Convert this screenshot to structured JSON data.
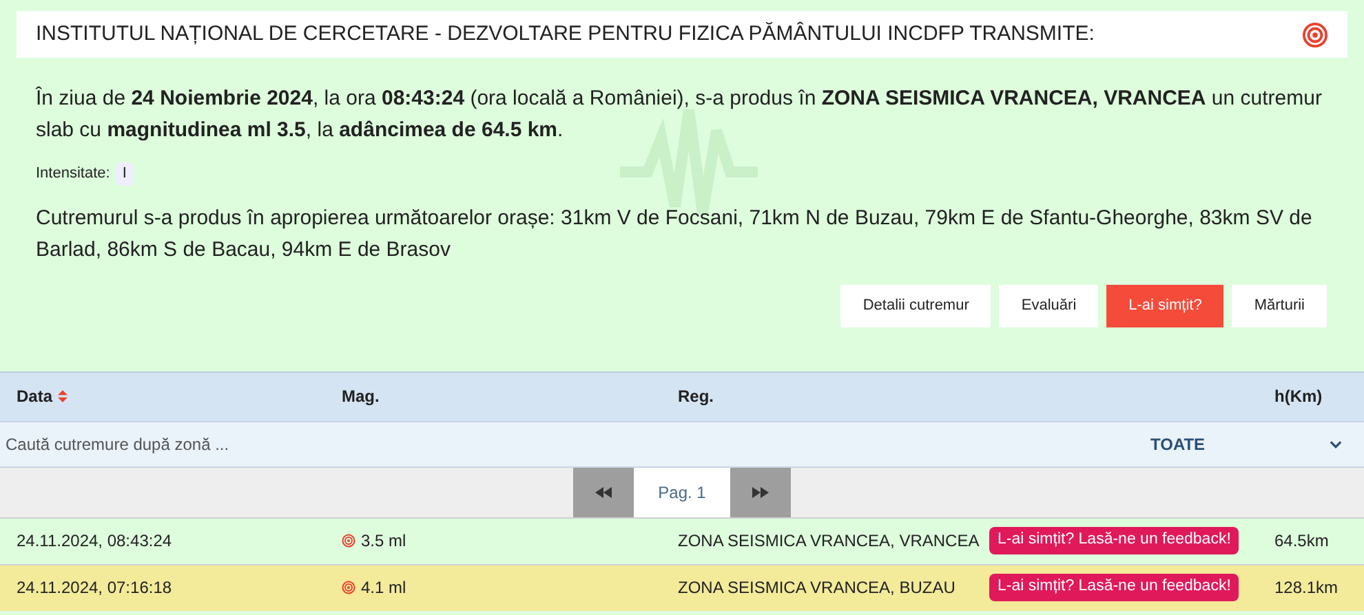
{
  "header": {
    "title": "INSTITUTUL NAȚIONAL DE CERCETARE - DEZVOLTARE PENTRU FIZICA PĂMÂNTULUI INCDFP TRANSMITE:"
  },
  "summary": "În ziua de **24 Noiembrie 2024**, la ora **08:43:24** (ora locală a României), s-a produs în **ZONA SEISMICA VRANCEA, VRANCEA** un cutremur slab cu **magnitudinea ml 3.5**, la **adâncimea de 64.5 km**.",
  "intensity": {
    "label": "Intensitate:",
    "value": "I"
  },
  "nearby": "Cutremurul s-a produs în apropierea următoarelor orașe: 31km V de Focsani, 71km N de Buzau, 79km E de Sfantu-Gheorghe, 83km SV de Barlad, 86km S de Bacau, 94km E de Brasov",
  "buttons": [
    {
      "label": "Detalii cutremur",
      "selected": false
    },
    {
      "label": "Evaluări",
      "selected": false
    },
    {
      "label": "L-ai simțit?",
      "selected": true
    },
    {
      "label": "Mărturii",
      "selected": false
    }
  ],
  "table": {
    "columns": [
      "Data",
      "Mag.",
      "Reg.",
      "h(Km)"
    ],
    "search": {
      "placeholder": "Caută cutremure după zonă ...",
      "filter": "TOATE"
    },
    "pager": {
      "page": "Pag. 1"
    },
    "rows": [
      {
        "date": "24.11.2024, 08:43:24",
        "mag": "3.5 ml",
        "region": "ZONA SEISMICA VRANCEA, VRANCEA",
        "feedback": "L-ai simțit? Lasă-ne un feedback!",
        "depth": "64.5km",
        "color": "#ddfddc"
      },
      {
        "date": "24.11.2024, 07:16:18",
        "mag": "4.1 ml",
        "region": "ZONA SEISMICA VRANCEA, BUZAU",
        "feedback": "L-ai simțit? Lasă-ne un feedback!",
        "depth": "128.1km",
        "color": "#f3ea9a"
      }
    ]
  }
}
